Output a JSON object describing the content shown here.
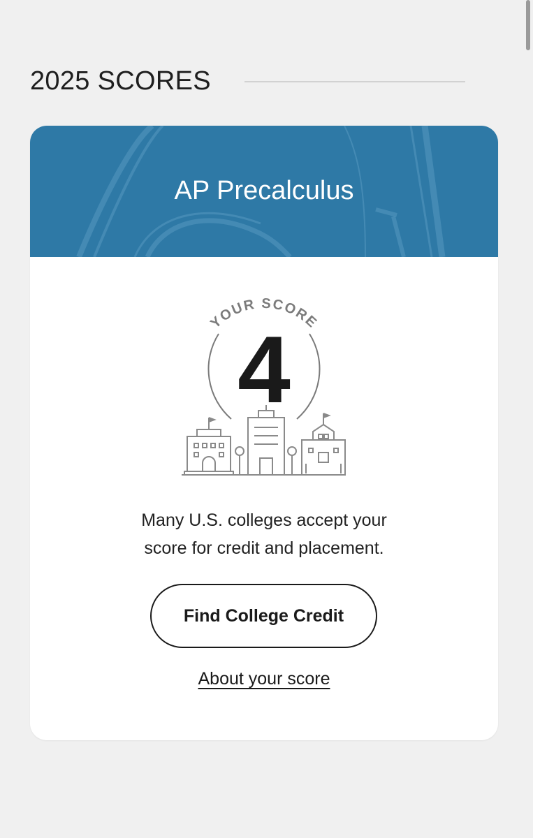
{
  "section": {
    "title": "2025 SCORES"
  },
  "card": {
    "course": "AP Precalculus",
    "score_label": "YOUR SCORE",
    "score": "4",
    "info_line1": "Many U.S. colleges accept your",
    "info_line2": "score for credit and placement.",
    "button_label": "Find College Credit",
    "link_label": "About your score"
  },
  "colors": {
    "banner": "#2e79a6",
    "background": "#f0f0f0",
    "card": "#ffffff",
    "text": "#1e1e1e"
  },
  "icons": [
    "bridge-arch-background",
    "score-ring",
    "college-buildings-icon"
  ]
}
